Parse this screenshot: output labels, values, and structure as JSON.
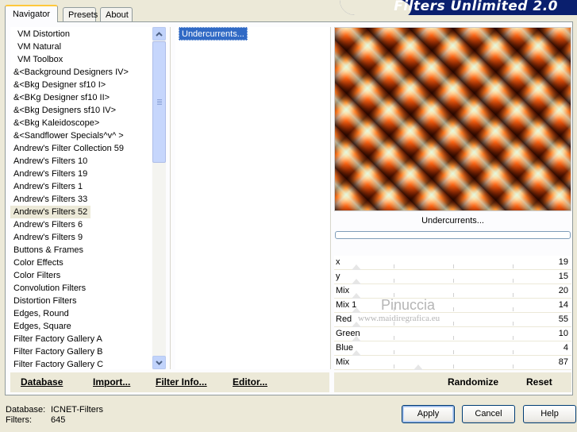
{
  "banner": {
    "title": "Filters Unlimited 2.0"
  },
  "tabs": [
    {
      "label": "Navigator",
      "active": true
    },
    {
      "label": "Presets",
      "active": false
    },
    {
      "label": "About",
      "active": false
    }
  ],
  "categories": {
    "items": [
      "VM Distortion",
      "VM Natural",
      "VM Toolbox",
      "&<Background Designers IV>",
      "&<Bkg Designer sf10 I>",
      "&<BKg Designer sf10 II>",
      "&<Bkg Designers sf10 IV>",
      "&<Bkg Kaleidoscope>",
      "&<Sandflower Specials^v^ >",
      "Andrew's Filter Collection 59",
      "Andrew's Filters 10",
      "Andrew's Filters 19",
      "Andrew's Filters 1",
      "Andrew's Filters 33",
      "Andrew's Filters 52",
      "Andrew's Filters 6",
      "Andrew's Filters 9",
      "Buttons & Frames",
      "Color Effects",
      "Color Filters",
      "Convolution Filters",
      "Distortion Filters",
      "Edges, Round",
      "Edges, Square",
      "Filter Factory Gallery A",
      "Filter Factory Gallery B",
      "Filter Factory Gallery C"
    ],
    "selected_index": 14
  },
  "filters": {
    "items": [
      "Undercurrents..."
    ],
    "selected_index": 0
  },
  "preview": {
    "caption": "Undercurrents..."
  },
  "sliders": [
    {
      "label": "x",
      "value": "19"
    },
    {
      "label": "y",
      "value": "15"
    },
    {
      "label": "Mix",
      "value": "20"
    },
    {
      "label": "Mix 1",
      "value": "14"
    },
    {
      "label": "Red",
      "value": "55"
    },
    {
      "label": "Green",
      "value": "10"
    },
    {
      "label": "Blue",
      "value": "4"
    },
    {
      "label": "Mix",
      "value": "87"
    }
  ],
  "watermark": {
    "line1": "Pinuccia",
    "line2": "www.maidiregrafica.eu"
  },
  "toolbar": {
    "database": "Database",
    "import": "Import...",
    "filter_info": "Filter Info...",
    "editor": "Editor...",
    "randomize": "Randomize",
    "reset": "Reset"
  },
  "status": {
    "database_label": "Database:",
    "database_value": "ICNET-Filters",
    "filters_label": "Filters:",
    "filters_value": "645"
  },
  "buttons": {
    "apply": "Apply",
    "cancel": "Cancel",
    "help": "Help"
  }
}
